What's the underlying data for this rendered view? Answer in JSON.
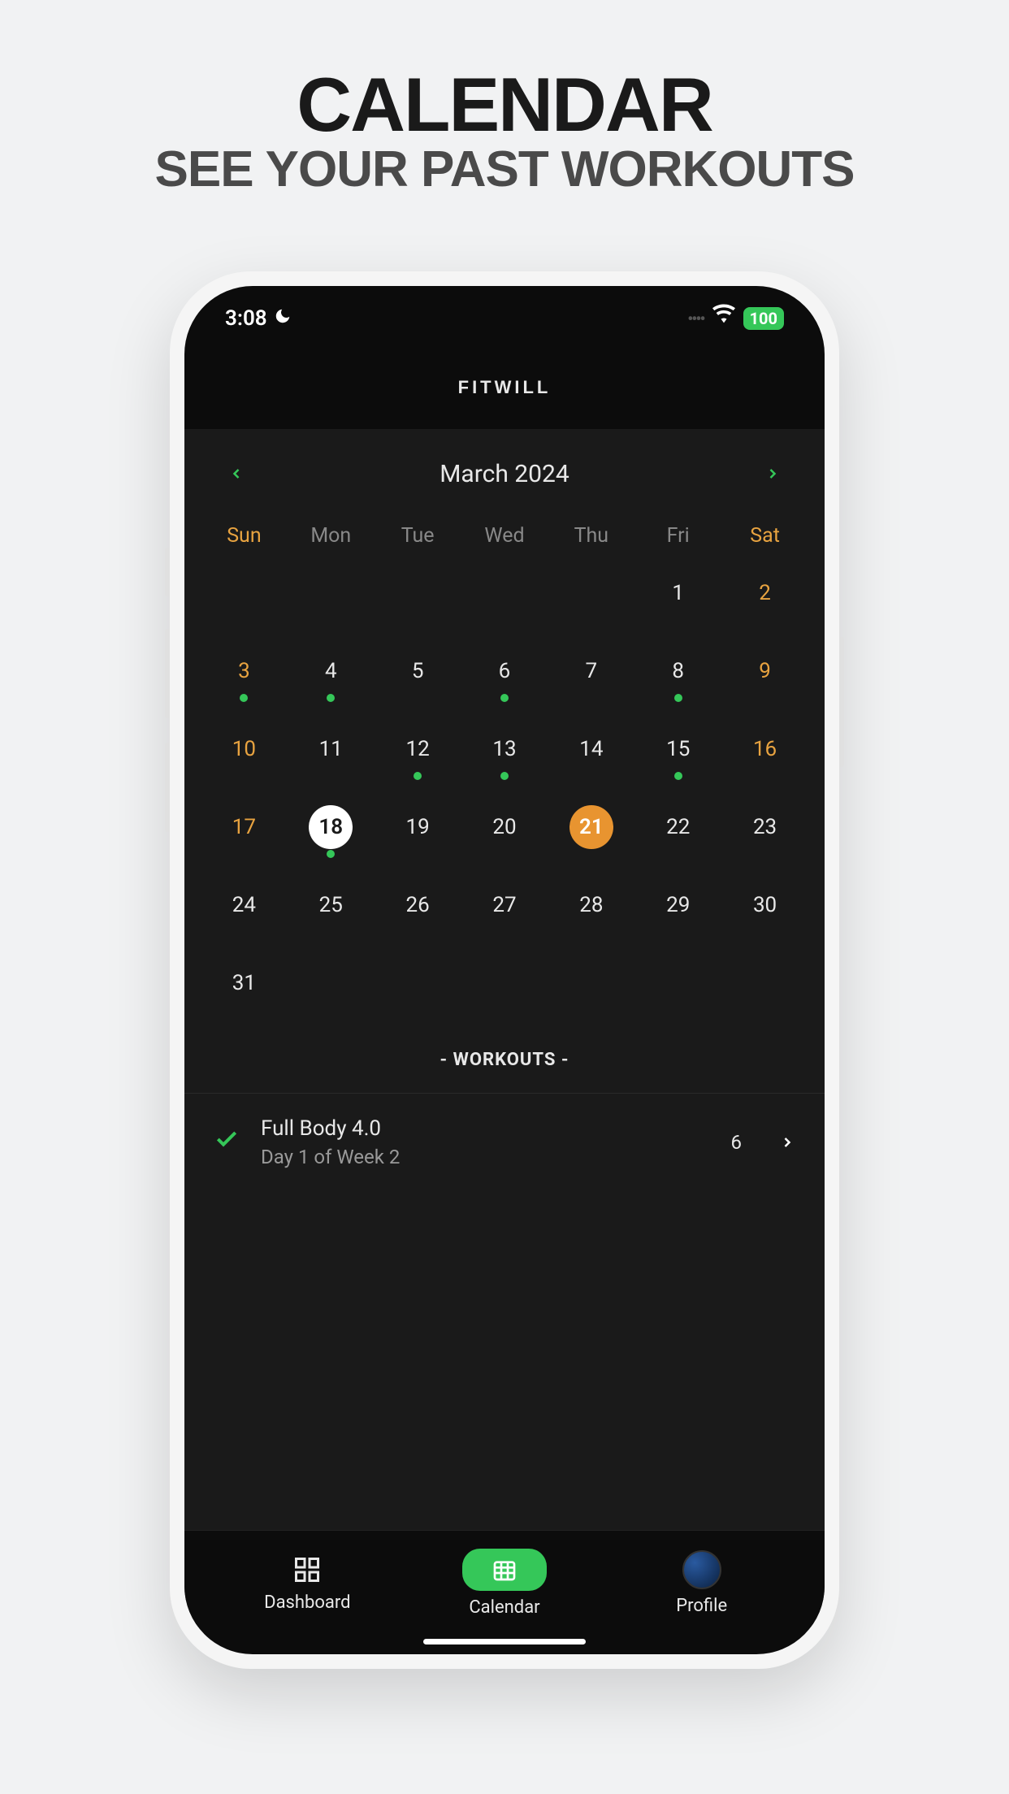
{
  "promo": {
    "title": "CALENDAR",
    "subtitle": "SEE YOUR PAST WORKOUTS"
  },
  "status_bar": {
    "time": "3:08",
    "battery": "100"
  },
  "app_title": "FITWILL",
  "calendar": {
    "month_title": "March 2024",
    "day_headers": [
      "Sun",
      "Mon",
      "Tue",
      "Wed",
      "Thu",
      "Fri",
      "Sat"
    ],
    "weeks": [
      [
        null,
        null,
        null,
        null,
        null,
        {
          "d": "1"
        },
        {
          "d": "2",
          "weekend": true
        }
      ],
      [
        {
          "d": "3",
          "weekend": true,
          "dot": true
        },
        {
          "d": "4",
          "dot": true
        },
        {
          "d": "5"
        },
        {
          "d": "6",
          "dot": true
        },
        {
          "d": "7"
        },
        {
          "d": "8",
          "dot": true
        },
        {
          "d": "9",
          "weekend": true
        }
      ],
      [
        {
          "d": "10",
          "weekend": true
        },
        {
          "d": "11"
        },
        {
          "d": "12",
          "dot": true
        },
        {
          "d": "13",
          "dot": true
        },
        {
          "d": "14"
        },
        {
          "d": "15",
          "dot": true
        },
        {
          "d": "16",
          "weekend": true
        }
      ],
      [
        {
          "d": "17",
          "weekend": true
        },
        {
          "d": "18",
          "today": true,
          "dot": true
        },
        {
          "d": "19"
        },
        {
          "d": "20"
        },
        {
          "d": "21",
          "selected": true
        },
        {
          "d": "22"
        },
        {
          "d": "23"
        }
      ],
      [
        {
          "d": "24"
        },
        {
          "d": "25"
        },
        {
          "d": "26"
        },
        {
          "d": "27"
        },
        {
          "d": "28"
        },
        {
          "d": "29"
        },
        {
          "d": "30"
        }
      ],
      [
        {
          "d": "31"
        },
        null,
        null,
        null,
        null,
        null,
        null
      ]
    ]
  },
  "workouts_label": "- WORKOUTS -",
  "workout_item": {
    "title": "Full Body 4.0",
    "subtitle": "Day 1 of Week 2",
    "count": "6"
  },
  "nav": {
    "dashboard": "Dashboard",
    "calendar": "Calendar",
    "profile": "Profile"
  }
}
